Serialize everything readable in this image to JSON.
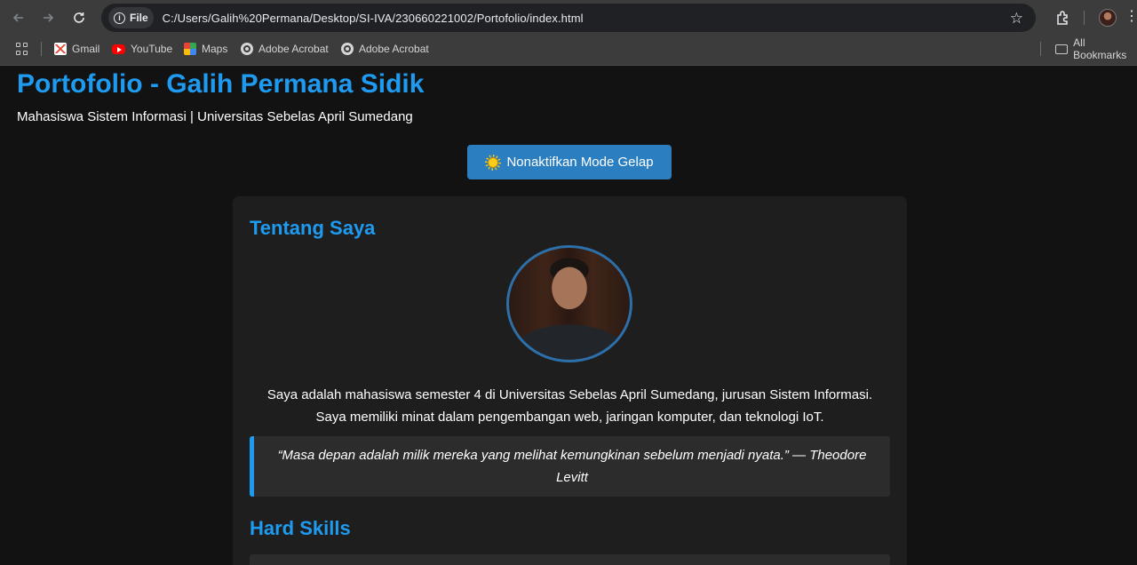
{
  "browser": {
    "file_label": "File",
    "url": "C:/Users/Galih%20Permana/Desktop/SI-IVA/230660221002/Portofolio/index.html",
    "bookmarks": [
      {
        "label": "Gmail",
        "icon": "gmail-icon"
      },
      {
        "label": "YouTube",
        "icon": "youtube-icon"
      },
      {
        "label": "Maps",
        "icon": "maps-icon"
      },
      {
        "label": "Adobe Acrobat",
        "icon": "acrobat-icon"
      },
      {
        "label": "Adobe Acrobat",
        "icon": "acrobat-icon"
      }
    ],
    "all_bookmarks_label": "All Bookmarks"
  },
  "page": {
    "title": "Portofolio - Galih Permana Sidik",
    "subtitle": "Mahasiswa Sistem Informasi | Universitas Sebelas April Sumedang",
    "mode_button_label": "Nonaktifkan Mode Gelap",
    "about": {
      "heading": "Tentang Saya",
      "line1": "Saya adalah mahasiswa semester 4 di Universitas Sebelas April Sumedang, jurusan Sistem Informasi.",
      "line2": "Saya memiliki minat dalam pengembangan web, jaringan komputer, dan teknologi IoT.",
      "quote": "“Masa depan adalah milik mereka yang melihat kemungkinan sebelum menjadi nyata.” — Theodore Levitt"
    },
    "hard_skills": {
      "heading": "Hard Skills"
    }
  },
  "colors": {
    "accent": "#1e9bf0",
    "button": "#2b7fc0",
    "background": "#121212",
    "card": "#1e1e1e"
  }
}
